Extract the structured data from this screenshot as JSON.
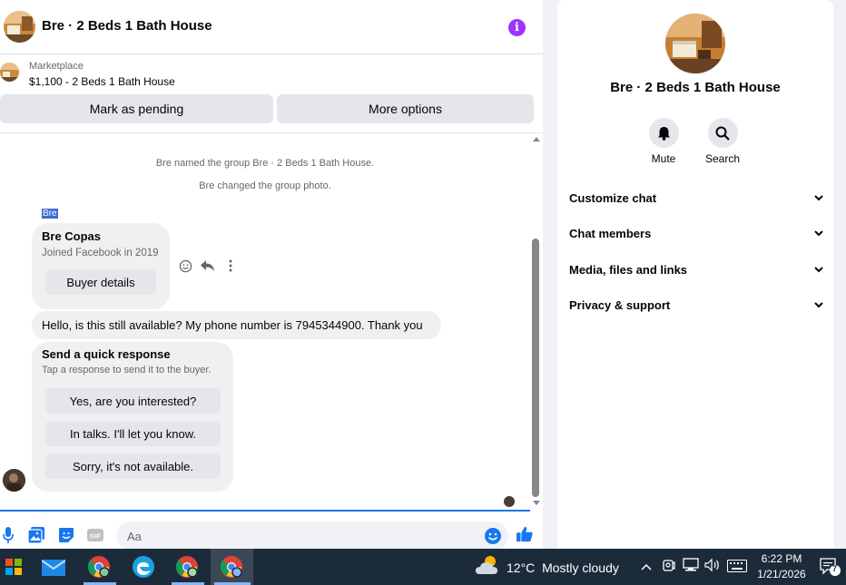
{
  "header": {
    "title": "Bre · 2 Beds 1 Bath House",
    "info_icon": "info-icon",
    "accent": "#a033ff"
  },
  "listing": {
    "source": "Marketplace",
    "title": "$1,100 - 2 Beds 1 Bath House"
  },
  "actions": {
    "pending": "Mark as pending",
    "more": "More options"
  },
  "system_messages": [
    "Bre named the group Bre · 2 Beds 1 Bath House.",
    "Bre changed the group photo."
  ],
  "sender_tag": "Bre",
  "buyer_card": {
    "name": "Bre Copas",
    "joined": "Joined Facebook in 2019",
    "button": "Buyer details"
  },
  "message_text": "Hello, is this still available? My phone number is 7945344900. Thank you",
  "quick_response": {
    "title": "Send a quick response",
    "subtitle": "Tap a response to send it to the buyer.",
    "options": [
      "Yes, are you interested?",
      "In talks. I'll let you know.",
      "Sorry, it's not available."
    ]
  },
  "composer": {
    "placeholder": "Aa"
  },
  "right_panel": {
    "title": "Bre · 2 Beds 1 Bath House",
    "mute": "Mute",
    "search": "Search",
    "sections": [
      "Customize chat",
      "Chat members",
      "Media, files and links",
      "Privacy & support"
    ]
  },
  "taskbar": {
    "temperature": "12°C",
    "weather": "Mostly cloudy",
    "time": "6:22 PM",
    "date": "1/21/2026",
    "notification_count": "7"
  }
}
